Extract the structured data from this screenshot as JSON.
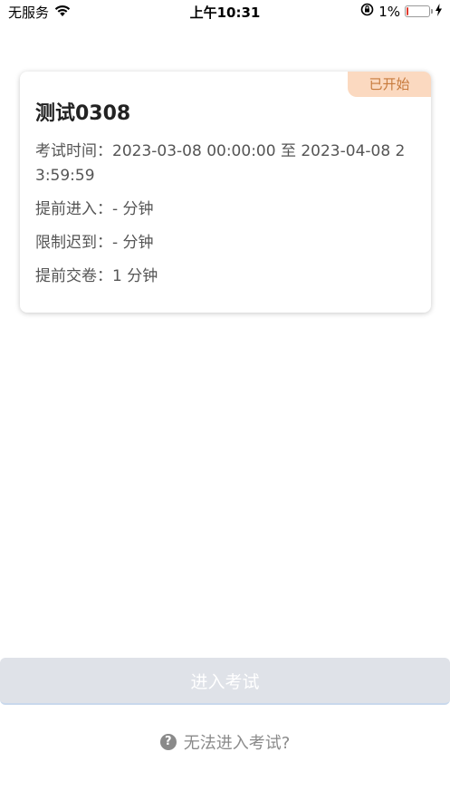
{
  "status_bar": {
    "carrier": "无服务",
    "time": "上午10:31",
    "battery_percent": "1%",
    "icons": [
      "wifi-icon",
      "orientation-lock-icon",
      "battery-icon",
      "charging-icon"
    ]
  },
  "exam_card": {
    "badge": "已开始",
    "title": "测试0308",
    "rows": [
      {
        "label": "考试时间：",
        "value": "2023-03-08 00:00:00 至 2023-04-08 23:59:59"
      },
      {
        "label": "提前进入：",
        "value": "- 分钟"
      },
      {
        "label": "限制迟到：",
        "value": "- 分钟"
      },
      {
        "label": "提前交卷：",
        "value": "1 分钟"
      }
    ]
  },
  "actions": {
    "enter_label": "进入考试",
    "help_label": "无法进入考试?",
    "help_icon": "question-circle-icon"
  },
  "colors": {
    "badge_bg": "#fbd9c0",
    "badge_text": "#c77a3c",
    "button_bg": "#dfe2e8",
    "battery_low": "#e33b2e"
  }
}
